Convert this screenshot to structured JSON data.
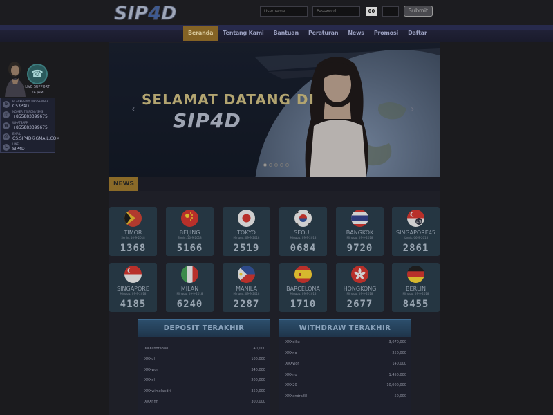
{
  "header": {
    "logo_text": "SIP4D",
    "username_placeholder": "Username",
    "password_placeholder": "Password",
    "captcha": "00",
    "submit_label": "Submit"
  },
  "nav": {
    "items": [
      "Beranda",
      "Tentang Kami",
      "Bantuan",
      "Peraturan",
      "News",
      "Promosi",
      "Daftar"
    ],
    "active_index": 0
  },
  "support": {
    "live_label_1": "LIVE SUPPORT",
    "live_label_2": "24 JAM",
    "contacts": [
      {
        "icon": "bbm-icon",
        "title": "BLACKBERRY MESSENGER",
        "value": "C53P4D"
      },
      {
        "icon": "phone-icon",
        "title": "NOMER TELPON / SMS",
        "value": "+855883399675"
      },
      {
        "icon": "whatsapp-icon",
        "title": "WHATSAPP",
        "value": "+855883399675"
      },
      {
        "icon": "email-icon",
        "title": "EMAIL",
        "value": "CS.SIP4D@GMAIL.COM"
      },
      {
        "icon": "line-icon",
        "title": "LINE",
        "value": "SIP4D"
      }
    ]
  },
  "banner": {
    "title": "SELAMAT DATANG DI",
    "logo_text": "SIP4D",
    "slide_count": 5,
    "active_slide": 0
  },
  "news": {
    "label": "NEWS"
  },
  "results": [
    {
      "city": "TIMOR",
      "date": "Senin, 10-9-2018",
      "number": "1368",
      "flag": "timor"
    },
    {
      "city": "BEIJING",
      "date": "Senin, 10-9-2018",
      "number": "5166",
      "flag": "china"
    },
    {
      "city": "TOKYO",
      "date": "Minggu, 09-9-2018",
      "number": "2519",
      "flag": "japan"
    },
    {
      "city": "SEOUL",
      "date": "Minggu, 09-9-2018",
      "number": "0684",
      "flag": "korea"
    },
    {
      "city": "BANGKOK",
      "date": "Minggu, 09-9-2018",
      "number": "9720",
      "flag": "thailand"
    },
    {
      "city": "SINGAPORE45",
      "date": "Kamis, 06-9-2018",
      "number": "2861",
      "flag": "singapore45"
    },
    {
      "city": "SINGAPORE",
      "date": "Minggu, 09-9-2018",
      "number": "4185",
      "flag": "singapore"
    },
    {
      "city": "MILAN",
      "date": "Minggu, 09-9-2018",
      "number": "6240",
      "flag": "italy"
    },
    {
      "city": "MANILA",
      "date": "Minggu, 09-9-2018",
      "number": "2287",
      "flag": "philippines"
    },
    {
      "city": "BARCELONA",
      "date": "Minggu, 09-9-2018",
      "number": "1710",
      "flag": "spain"
    },
    {
      "city": "HONGKONG",
      "date": "Minggu, 09-9-2018",
      "number": "2677",
      "flag": "hongkong"
    },
    {
      "city": "BERLIN",
      "date": "Minggu, 09-9-2018",
      "number": "8455",
      "flag": "germany"
    }
  ],
  "deposit": {
    "title": "DEPOSIT TERAKHIR",
    "rows": [
      {
        "name": "XXXandra888",
        "amount": "40,000"
      },
      {
        "name": "XXXul",
        "amount": "100,000"
      },
      {
        "name": "XXXwor",
        "amount": "340,000"
      },
      {
        "name": "XXXdl",
        "amount": "200,000"
      },
      {
        "name": "XXXwimelandri",
        "amount": "350,000"
      },
      {
        "name": "XXXnnn",
        "amount": "300,000"
      }
    ]
  },
  "withdraw": {
    "title": "WITHDRAW TERAKHIR",
    "rows": [
      {
        "name": "XXXoiku",
        "amount": "3,070,000"
      },
      {
        "name": "XXXno",
        "amount": "250,000"
      },
      {
        "name": "XXXwor",
        "amount": "140,000"
      },
      {
        "name": "XXXng",
        "amount": "1,450,000"
      },
      {
        "name": "XXX20",
        "amount": "10,000,000"
      },
      {
        "name": "XXXandra88",
        "amount": "50,000"
      }
    ]
  }
}
